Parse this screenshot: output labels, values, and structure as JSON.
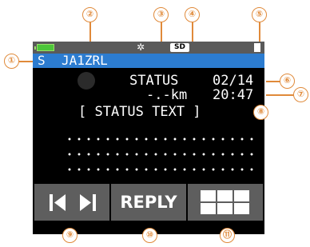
{
  "callouts": [
    "①",
    "②",
    "③",
    "④",
    "⑤",
    "⑥",
    "⑦",
    "⑧",
    "⑨",
    "⑩",
    "⑪"
  ],
  "status_bar": {
    "sd_label": "SD",
    "icons": [
      "battery-icon",
      "satellite-icon",
      "sd-card-icon",
      "document-icon"
    ]
  },
  "title_bar": {
    "mode": "S",
    "callsign": "JA1ZRL"
  },
  "message": {
    "status_label": "STATUS",
    "distance": "-.-km",
    "date": "02/14",
    "time": "20:47",
    "status_text": "[ STATUS TEXT ]"
  },
  "buttons": {
    "reply_label": "REPLY",
    "icons": [
      "prev-next-icon",
      "menu-grid-icon"
    ]
  },
  "colors": {
    "title_bar": "#2c7cd0",
    "status_bar": "#5a5a5a",
    "button": "#5e5e5e",
    "callout": "#e08a3a",
    "battery": "#4cc63a"
  }
}
